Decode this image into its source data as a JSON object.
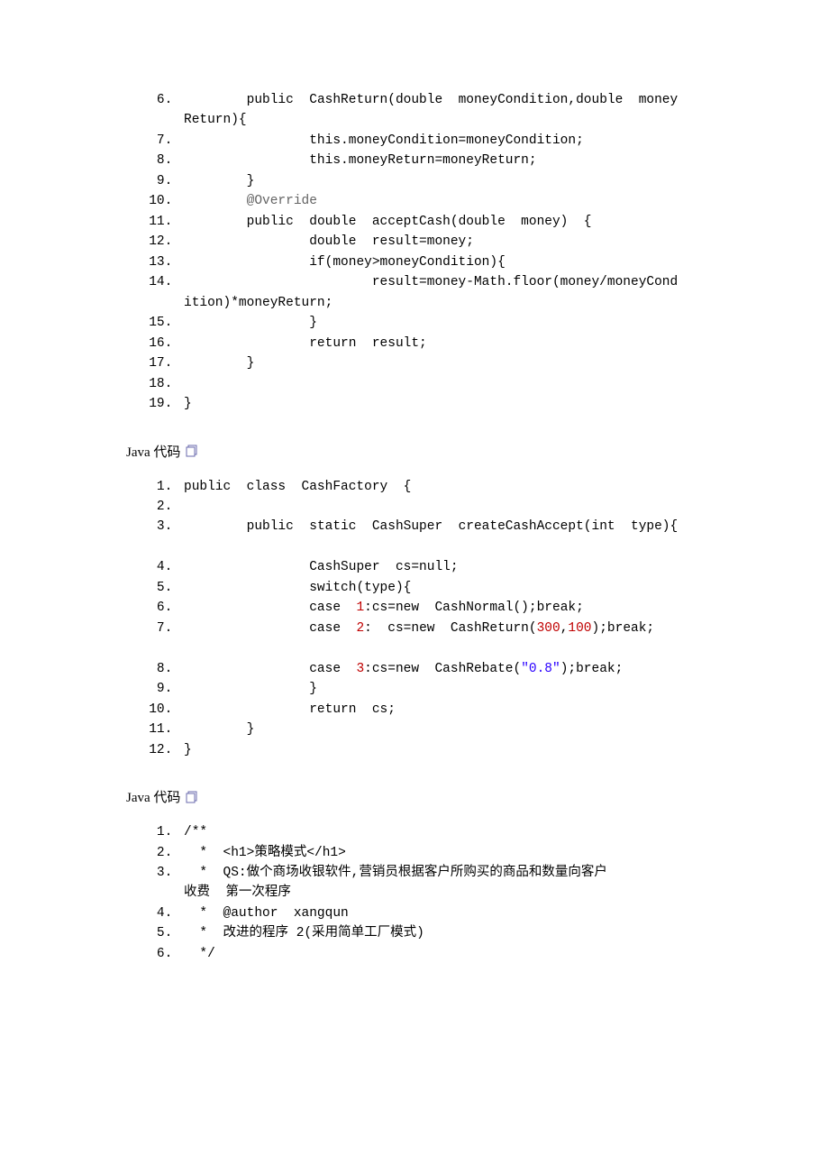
{
  "label1": "Java 代码",
  "label2": "Java 代码",
  "block1": {
    "l6a": "        public  CashReturn(double  moneyCondition,double  money",
    "l6b": "Return){",
    "l7": "                this.moneyCondition=moneyCondition;",
    "l8": "                this.moneyReturn=moneyReturn;",
    "l9": "        }",
    "l10": "        @Override",
    "l11": "        public  double  acceptCash(double  money)  {",
    "l12": "                double  result=money;",
    "l13": "                if(money>moneyCondition){",
    "l14a": "                        result=money-Math.floor(money/moneyCond",
    "l14b": "ition)*moneyReturn;",
    "l15": "                }",
    "l16": "                return  result;",
    "l17": "        }",
    "l18": "",
    "l19": "}"
  },
  "block2": {
    "l1": "public  class  CashFactory  {",
    "l2": "",
    "l3": "        public  static  CashSuper  createCashAccept(int  type){",
    "l4": "                CashSuper  cs=null;",
    "l5": "                switch(type){",
    "l6_p1": "                case  ",
    "l6_n": "1",
    "l6_p2": ":cs=new  CashNormal();break;",
    "l7_p1": "                case  ",
    "l7_n": "2",
    "l7_p2": ":  cs=new  CashReturn(",
    "l7_n2": "300",
    "l7_c": ",",
    "l7_n3": "100",
    "l7_p3": ");break;",
    "l8_p1": "                case  ",
    "l8_n": "3",
    "l8_p2": ":cs=new  CashRebate(",
    "l8_s": "\"0.8\"",
    "l8_p3": ");break;",
    "l9": "                }",
    "l10": "                return  cs;",
    "l11": "        }",
    "l12": "}"
  },
  "block3": {
    "l1": "/**",
    "l2": "  *  <h1>策略模式</h1>",
    "l3a": "  *  QS:做个商场收银软件,营销员根据客户所购买的商品和数量向客户",
    "l3b": "收费  第一次程序",
    "l4": "  *  @author  xangqun",
    "l5": "  *  改进的程序 2(采用简单工厂模式)",
    "l6": "  */"
  }
}
